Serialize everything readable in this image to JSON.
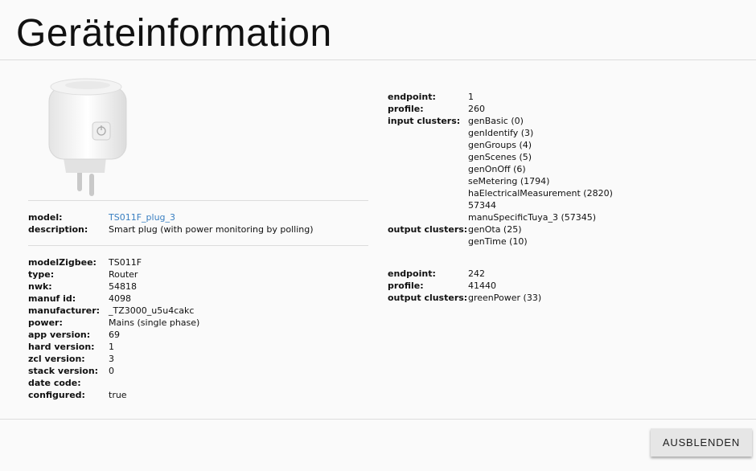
{
  "page_title": "Geräteinformation",
  "device_summary": {
    "model_label": "model:",
    "model_value": "TS011F_plug_3",
    "description_label": "description:",
    "description_value": "Smart plug (with power monitoring by polling)"
  },
  "device_details": [
    {
      "label": "modelZigbee:",
      "value": "TS011F"
    },
    {
      "label": "type:",
      "value": "Router"
    },
    {
      "label": "nwk:",
      "value": "54818"
    },
    {
      "label": "manuf id:",
      "value": "4098"
    },
    {
      "label": "manufacturer:",
      "value": "_TZ3000_u5u4cakc"
    },
    {
      "label": "power:",
      "value": "Mains (single phase)"
    },
    {
      "label": "app version:",
      "value": "69"
    },
    {
      "label": "hard version:",
      "value": "1"
    },
    {
      "label": "zcl version:",
      "value": "3"
    },
    {
      "label": "stack version:",
      "value": "0"
    },
    {
      "label": "date code:",
      "value": ""
    },
    {
      "label": "configured:",
      "value": "true"
    }
  ],
  "endpoints": [
    {
      "endpoint_label": "endpoint:",
      "endpoint": "1",
      "profile_label": "profile:",
      "profile": "260",
      "input_label": "input clusters:",
      "input_clusters": [
        "genBasic (0)",
        "genIdentify (3)",
        "genGroups (4)",
        "genScenes (5)",
        "genOnOff (6)",
        "seMetering (1794)",
        "haElectricalMeasurement (2820)",
        "57344",
        "manuSpecificTuya_3 (57345)"
      ],
      "output_label": "output clusters:",
      "output_clusters": [
        "genOta (25)",
        "genTime (10)"
      ]
    },
    {
      "endpoint_label": "endpoint:",
      "endpoint": "242",
      "profile_label": "profile:",
      "profile": "41440",
      "output_label": "output clusters:",
      "output_clusters": [
        "greenPower (33)"
      ]
    }
  ],
  "hide_button_label": "AUSBLENDEN",
  "colors": {
    "link": "#3a7fc1",
    "button_bg": "#e6e6e6"
  }
}
